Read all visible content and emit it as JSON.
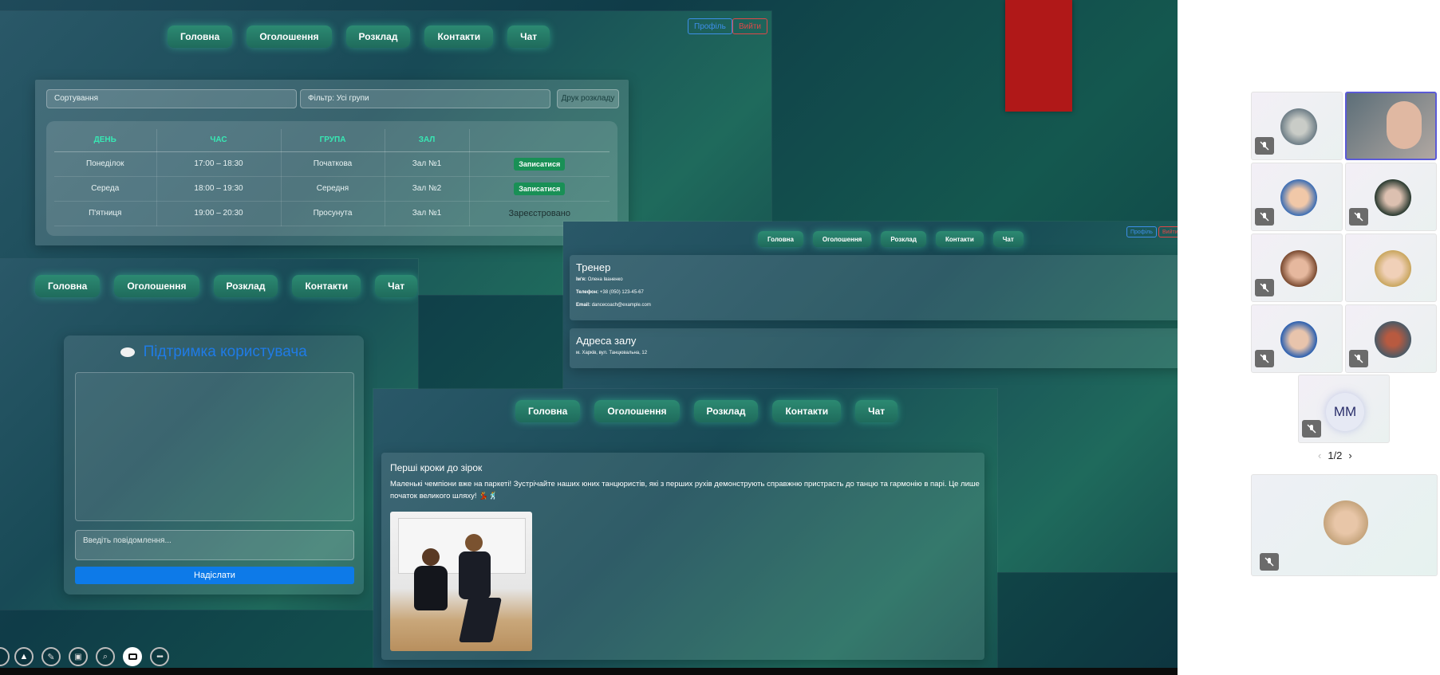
{
  "nav": [
    "Головна",
    "Оголошення",
    "Розклад",
    "Контакти",
    "Чат"
  ],
  "auth": {
    "profile": "Профіль",
    "logout": "Вийти"
  },
  "schedule": {
    "sort_label": "Сортування",
    "filter_label": "Фільтр: Усі групи",
    "print_button": "Друк розкладу",
    "headers": [
      "ДЕНЬ",
      "ЧАС",
      "ГРУПА",
      "ЗАЛ",
      ""
    ],
    "rows": [
      {
        "day": "Понеділок",
        "time": "17:00 – 18:30",
        "group": "Початкова",
        "hall": "Зал №1",
        "action": "Записатися"
      },
      {
        "day": "Середа",
        "time": "18:00 – 19:30",
        "group": "Середня",
        "hall": "Зал №2",
        "action": "Записатися"
      },
      {
        "day": "П'ятниця",
        "time": "19:00 – 20:30",
        "group": "Просунута",
        "hall": "Зал №1",
        "action": "Зареєстровано"
      }
    ]
  },
  "support": {
    "title": "Підтримка користувача",
    "input_placeholder": "Введіть повідомлення...",
    "send_button": "Надіслати"
  },
  "contacts": {
    "coach_title": "Тренер",
    "name_label": "Ім'я:",
    "name_value": "Олена Іваненко",
    "phone_label": "Телефон:",
    "phone_value": "+38 (050) 123-45-67",
    "email_label": "Email:",
    "email_value": "dancecoach@example.com",
    "address_title": "Адреса залу",
    "address_value": "м. Харків, вул. Танцювальна, 12"
  },
  "news": {
    "title": "Перші кроки до зірок",
    "text": "Маленькі чемпіони вже на паркеті! Зустрічайте наших юних танцюристів, які з перших рухів демонструють справжню пристрасть до танцю та гармонію в парі. Це лише початок великого шляху! 💃🕺"
  },
  "participants": {
    "initials": "MM",
    "pager": "1/2"
  },
  "colors": {
    "accent": "#38e8b4",
    "send": "#0d7ae8",
    "join": "#199056",
    "red_block": "#b01818"
  }
}
